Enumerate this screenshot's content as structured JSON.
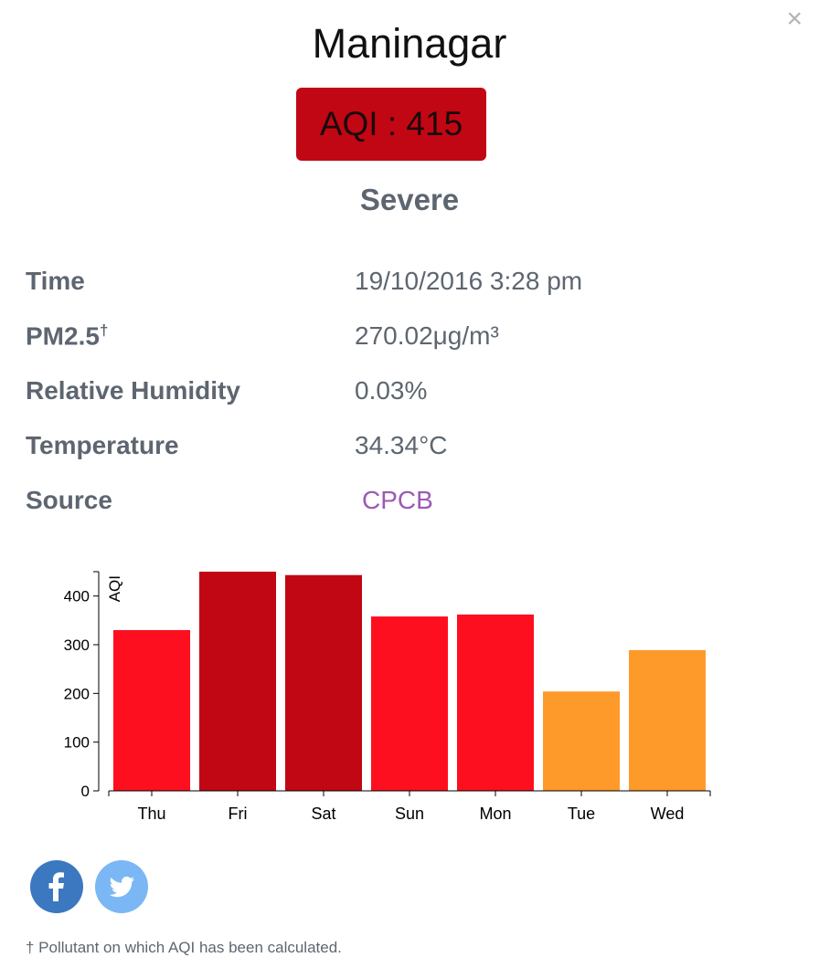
{
  "station": {
    "name": "Maninagar",
    "aqi_label": "AQI : 415",
    "category": "Severe"
  },
  "close_label": "×",
  "info": {
    "time_label": "Time",
    "time_value": "19/10/2016 3:28 pm",
    "pm_label": "PM2.5",
    "pm_marker": "†",
    "pm_value": "270.02μg/m³",
    "humidity_label": "Relative Humidity",
    "humidity_value": "0.03%",
    "temp_label": "Temperature",
    "temp_value": "34.34°C",
    "source_label": "Source",
    "source_value": "CPCB"
  },
  "chart_data": {
    "type": "bar",
    "categories": [
      "Thu",
      "Fri",
      "Sat",
      "Sun",
      "Mon",
      "Tue",
      "Wed"
    ],
    "values": [
      330,
      450,
      443,
      358,
      362,
      204,
      289
    ],
    "colors": [
      "#fe0f1f",
      "#c10714",
      "#c10714",
      "#fe0f1f",
      "#fe0f1f",
      "#fe9a2a",
      "#fe9a2a"
    ],
    "ylabel": "AQI",
    "yticks": [
      0,
      100,
      200,
      300,
      400
    ],
    "ylim": [
      0,
      450
    ]
  },
  "social": {
    "facebook": "f",
    "twitter": "twitter"
  },
  "footnote": "† Pollutant on which AQI has been calculated."
}
